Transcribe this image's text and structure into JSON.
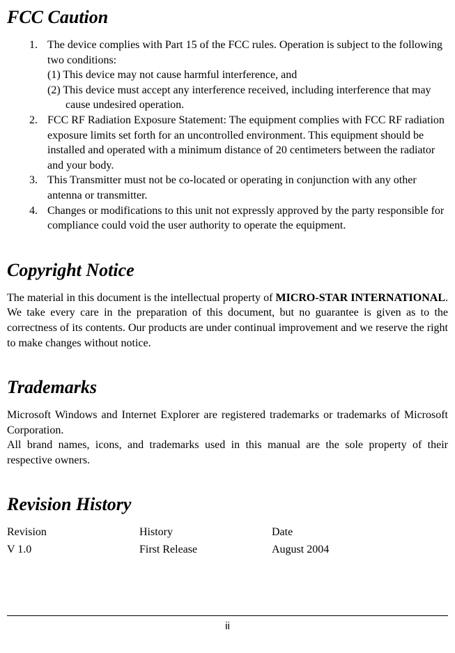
{
  "sections": {
    "fcc": {
      "title": "FCC Caution",
      "items": [
        {
          "num": "1.",
          "text": "The device complies with Part 15 of the FCC rules. Operation is subject to the following two conditions:",
          "sub": [
            "(1) This device may not cause harmful interference, and",
            "(2) This device must accept any interference received, including interference that may cause undesired operation."
          ]
        },
        {
          "num": "2.",
          "text": "FCC RF Radiation Exposure Statement: The equipment complies with FCC RF radiation exposure limits set forth for an uncontrolled environment. This equipment should be installed and operated with a minimum distance of 20 centimeters between the radiator and your body."
        },
        {
          "num": "3.",
          "text": "This Transmitter must not be co-located or operating in conjunction with any other antenna or transmitter."
        },
        {
          "num": "4.",
          "text": "Changes or modifications to this unit not expressly approved by the party responsible for compliance could void the user authority to operate the equipment."
        }
      ]
    },
    "copyright": {
      "title": "Copyright Notice",
      "text_pre": "The material in this document is the intellectual property of ",
      "text_bold": "MICRO-STAR INTERNATIONAL",
      "text_post": ".  We take every care in the preparation of this document, but no guarantee is given as to the correctness of its contents.  Our products are under continual improvement and we reserve the right to make changes without notice."
    },
    "trademarks": {
      "title": "Trademarks",
      "text": "Microsoft Windows and Internet Explorer are registered trademarks or trademarks of Microsoft Corporation.\nAll brand names, icons, and trademarks used in this manual are the sole property of their respective owners."
    },
    "revision": {
      "title": "Revision History",
      "headers": {
        "c1": "Revision",
        "c2": "History",
        "c3": "Date"
      },
      "row": {
        "c1": "V 1.0",
        "c2": "First Release",
        "c3": "August 2004"
      }
    }
  },
  "page_number": "ii"
}
